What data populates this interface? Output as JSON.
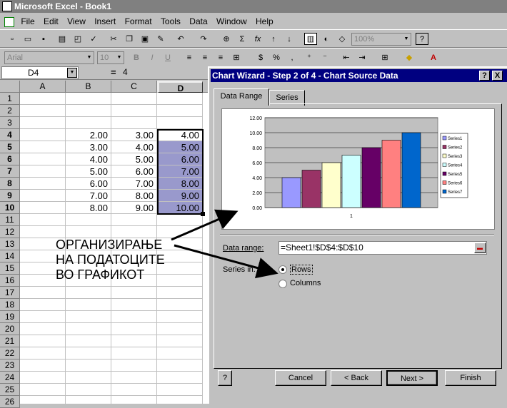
{
  "window": {
    "title": "Microsoft Excel - Book1"
  },
  "menu": [
    "File",
    "Edit",
    "View",
    "Insert",
    "Format",
    "Tools",
    "Data",
    "Window",
    "Help"
  ],
  "toolbar": {
    "zoom": "100%",
    "font": "Arial",
    "font_size": "10"
  },
  "formula_bar": {
    "name_box": "D4",
    "eq": "=",
    "value": "4"
  },
  "columns": [
    "A",
    "B",
    "C",
    "D"
  ],
  "rows": [
    "1",
    "2",
    "3",
    "4",
    "5",
    "6",
    "7",
    "8",
    "9",
    "10",
    "11",
    "12",
    "13",
    "14",
    "15",
    "16",
    "17",
    "18",
    "19",
    "20",
    "21",
    "22",
    "23",
    "24",
    "25",
    "26"
  ],
  "cells": {
    "B": [
      "2.00",
      "3.00",
      "4.00",
      "5.00",
      "6.00",
      "7.00",
      "8.00"
    ],
    "C": [
      "3.00",
      "4.00",
      "5.00",
      "6.00",
      "7.00",
      "8.00",
      "9.00"
    ],
    "D": [
      "4.00",
      "5.00",
      "6.00",
      "7.00",
      "8.00",
      "9.00",
      "10.00"
    ]
  },
  "dialog": {
    "title": "Chart Wizard - Step 2 of 4 - Chart Source Data",
    "help_btn": "?",
    "close_btn": "X",
    "tabs": [
      "Data Range",
      "Series"
    ],
    "data_range_label": "Data range:",
    "data_range_value": "=Sheet1!$D$4:$D$10",
    "series_in_label": "Series in:",
    "rows_label": "Rows",
    "columns_label": "Columns",
    "buttons": {
      "cancel": "Cancel",
      "back": "< Back",
      "next": "Next >",
      "finish": "Finish"
    }
  },
  "annotation": [
    "ОРГАНИЗИРАЊЕ",
    "НА ПОДАТОЦИТЕ",
    "ВО ГРАФИКОТ"
  ],
  "chart_data": {
    "type": "bar",
    "categories": [
      "1"
    ],
    "ylim": [
      0,
      12
    ],
    "yticks": [
      "12.00",
      "10.00",
      "8.00",
      "6.00",
      "4.00",
      "2.00",
      "0.00"
    ],
    "series": [
      {
        "name": "Series1",
        "values": [
          4
        ],
        "color": "#9999ff"
      },
      {
        "name": "Series2",
        "values": [
          5
        ],
        "color": "#993366"
      },
      {
        "name": "Series3",
        "values": [
          6
        ],
        "color": "#ffffcc"
      },
      {
        "name": "Series4",
        "values": [
          7
        ],
        "color": "#ccffff"
      },
      {
        "name": "Series5",
        "values": [
          8
        ],
        "color": "#660066"
      },
      {
        "name": "Series6",
        "values": [
          9
        ],
        "color": "#ff8080"
      },
      {
        "name": "Series7",
        "values": [
          10
        ],
        "color": "#0066cc"
      }
    ],
    "grid": true,
    "legend": "right"
  }
}
